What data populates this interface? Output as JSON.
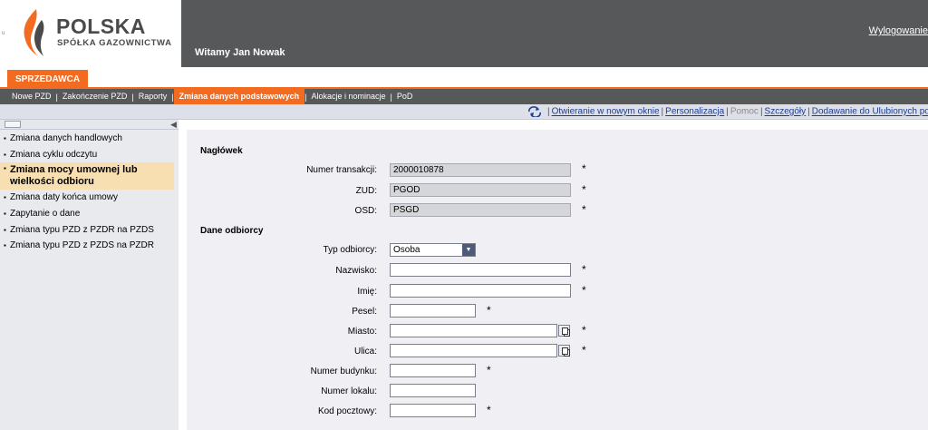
{
  "header": {
    "brand": "POLSKA",
    "brand_sub": "SPÓŁKA GAZOWNICTWA",
    "welcome": "Witamy Jan Nowak",
    "logout": "Wylogowanie",
    "accent_color": "#f36b21",
    "dark_color": "#57585a"
  },
  "role_tab": "SPRZEDAWCA",
  "nav": [
    {
      "label": "Nowe PZD"
    },
    {
      "label": "Zakończenie PZD"
    },
    {
      "label": "Raporty"
    },
    {
      "label": "Zmiana danych podstawowych"
    },
    {
      "label": "Alokacje i nominacje"
    },
    {
      "label": "PoD"
    }
  ],
  "links": {
    "open_new_window": "Otwieranie w nowym oknie",
    "personalize": "Personalizacja",
    "help": "Pomoc",
    "details": "Szczegóły",
    "add_favorites": "Dodawanie do Ulubionych porta"
  },
  "sidebar": {
    "items": [
      {
        "label": "Zmiana danych handlowych"
      },
      {
        "label": "Zmiana cyklu odczytu"
      },
      {
        "label": "Zmiana mocy umownej lub wielkości odbioru"
      },
      {
        "label": "Zmiana daty końca umowy"
      },
      {
        "label": "Zapytanie o dane"
      },
      {
        "label": "Zmiana typu PZD z PZDR na PZDS"
      },
      {
        "label": "Zmiana typu PZD z PZDS na PZDR"
      }
    ]
  },
  "form": {
    "section_header": "Nagłówek",
    "section_customer": "Dane odbiorcy",
    "required_mark": "*",
    "fields": {
      "transaction_no": {
        "label": "Numer transakcji:",
        "value": "2000010878"
      },
      "zud": {
        "label": "ZUD:",
        "value": "PGOD"
      },
      "osd": {
        "label": "OSD:",
        "value": "PSGD"
      },
      "customer_type": {
        "label": "Typ odbiorcy:",
        "value": "Osoba"
      },
      "surname": {
        "label": "Nazwisko:",
        "value": ""
      },
      "first_name": {
        "label": "Imię:",
        "value": ""
      },
      "pesel": {
        "label": "Pesel:",
        "value": ""
      },
      "city": {
        "label": "Miasto:",
        "value": ""
      },
      "street": {
        "label": "Ulica:",
        "value": ""
      },
      "building_no": {
        "label": "Numer budynku:",
        "value": ""
      },
      "unit_no": {
        "label": "Numer lokalu:",
        "value": ""
      },
      "postal_code": {
        "label": "Kod pocztowy:",
        "value": ""
      }
    }
  }
}
